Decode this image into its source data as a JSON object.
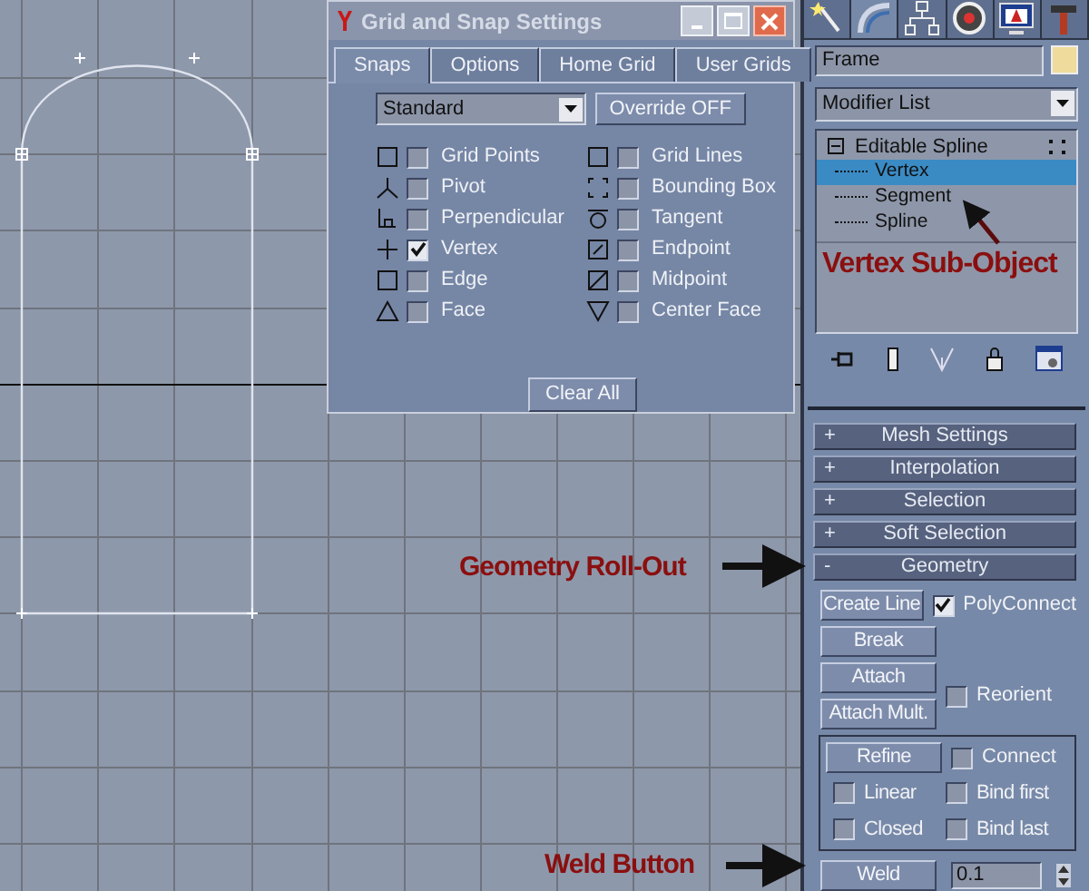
{
  "dialog": {
    "title": "Grid and Snap Settings",
    "tabs": [
      {
        "label": "Snaps",
        "selected": true
      },
      {
        "label": "Options",
        "selected": false
      },
      {
        "label": "Home Grid",
        "selected": false
      },
      {
        "label": "User Grids",
        "selected": false
      }
    ],
    "preset": {
      "value": "Standard"
    },
    "override_button": "Override OFF",
    "snaps_left": [
      {
        "label": "Grid Points",
        "checked": false
      },
      {
        "label": "Pivot",
        "checked": false
      },
      {
        "label": "Perpendicular",
        "checked": false
      },
      {
        "label": "Vertex",
        "checked": true
      },
      {
        "label": "Edge",
        "checked": false
      },
      {
        "label": "Face",
        "checked": false
      }
    ],
    "snaps_right": [
      {
        "label": "Grid Lines",
        "checked": false
      },
      {
        "label": "Bounding Box",
        "checked": false
      },
      {
        "label": "Tangent",
        "checked": false
      },
      {
        "label": "Endpoint",
        "checked": false
      },
      {
        "label": "Midpoint",
        "checked": false
      },
      {
        "label": "Center Face",
        "checked": false
      }
    ],
    "clear_button": "Clear All"
  },
  "command_panel": {
    "name_field": {
      "value": "Frame"
    },
    "modifier_list": {
      "value": "Modifier List"
    },
    "stack": [
      {
        "label": "Editable Spline",
        "selected": false,
        "expanded": true,
        "children": [
          {
            "label": "Vertex",
            "selected": true
          },
          {
            "label": "Segment",
            "selected": false
          },
          {
            "label": "Spline",
            "selected": false
          }
        ]
      }
    ],
    "rollouts": [
      {
        "sign": "+",
        "label": "Mesh Settings"
      },
      {
        "sign": "+",
        "label": "Interpolation"
      },
      {
        "sign": "+",
        "label": "Selection"
      },
      {
        "sign": "+",
        "label": "Soft Selection"
      },
      {
        "sign": "-",
        "label": "Geometry"
      }
    ],
    "geometry": {
      "create_line": "Create Line",
      "polyconnect": {
        "label": "PolyConnect",
        "checked": true
      },
      "break": "Break",
      "attach": "Attach",
      "attach_mult": "Attach Mult.",
      "reorient": {
        "label": "Reorient",
        "checked": false
      },
      "refine": "Refine",
      "connect": {
        "label": "Connect",
        "checked": false
      },
      "linear": {
        "label": "Linear",
        "checked": false
      },
      "bind_first": {
        "label": "Bind first",
        "checked": false
      },
      "closed": {
        "label": "Closed",
        "checked": false
      },
      "bind_last": {
        "label": "Bind last",
        "checked": false
      },
      "weld": "Weld",
      "weld_value": "0.1"
    }
  },
  "annotations": [
    {
      "text": "Vertex Sub-Object"
    },
    {
      "text": "Geometry Roll-Out"
    },
    {
      "text": "Weld Button"
    }
  ]
}
